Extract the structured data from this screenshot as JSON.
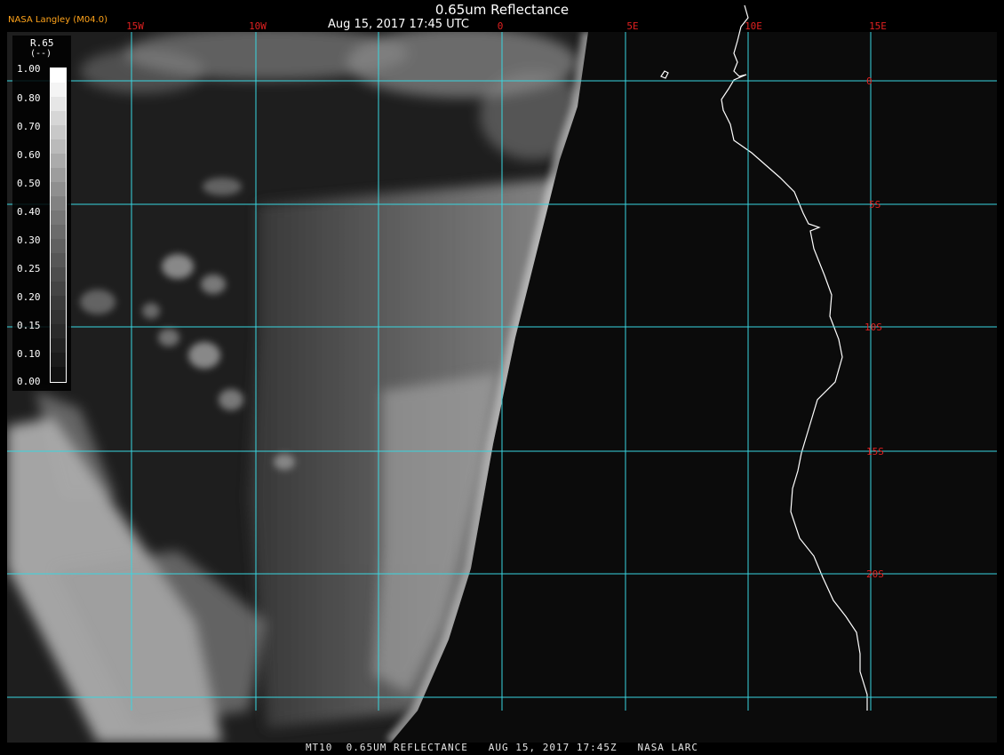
{
  "header": {
    "title": "0.65um Reflectance",
    "subtitle": "Aug 15, 2017 17:45 UTC",
    "credit": "NASA Langley (M04.0)"
  },
  "footer": {
    "text": "MT10  0.65UM REFLECTANCE   AUG 15, 2017 17:45Z   NASA LARC"
  },
  "colorbar": {
    "variable": "R.65",
    "unit": "(--)",
    "ticks": [
      "1.00",
      "0.80",
      "0.70",
      "0.60",
      "0.50",
      "0.40",
      "0.30",
      "0.25",
      "0.20",
      "0.15",
      "0.10",
      "0.00"
    ]
  },
  "grid": {
    "lon_labels": [
      "15W",
      "10W",
      "0",
      "5E",
      "10E",
      "15E"
    ],
    "lat_labels": [
      "0",
      "5S",
      "10S",
      "15S",
      "20S"
    ],
    "lon_values": [
      -15,
      -10,
      0,
      5,
      10,
      15
    ],
    "lat_values": [
      0,
      -5,
      -10,
      -15,
      -20
    ],
    "line_color": "#38d6e0",
    "label_color": "#e02020"
  },
  "colors": {
    "background": "#000000",
    "space": "#0b0b0b",
    "coastline": "#ffffff"
  }
}
